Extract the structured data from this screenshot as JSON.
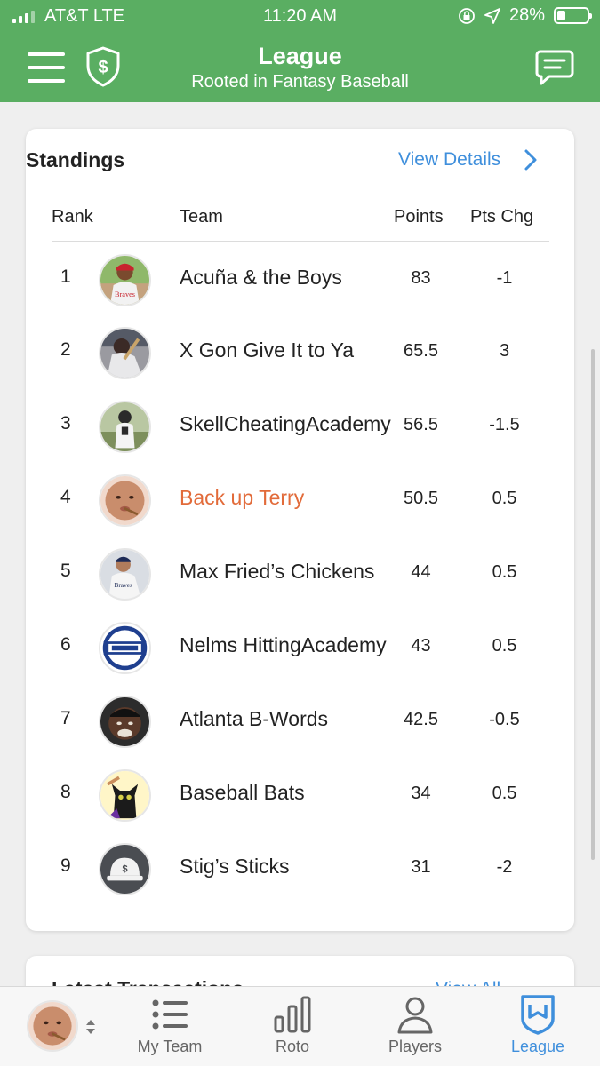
{
  "status_bar": {
    "carrier": "AT&T  LTE",
    "time": "11:20 AM",
    "battery_percent": "28%",
    "battery_level": 0.28
  },
  "header": {
    "title": "League",
    "subtitle": "Rooted in Fantasy Baseball"
  },
  "standings": {
    "title": "Standings",
    "view_details_label": "View Details",
    "columns": {
      "rank": "Rank",
      "team": "Team",
      "points": "Points",
      "pts_chg": "Pts Chg"
    },
    "rows": [
      {
        "rank": "1",
        "team": "Acuña & the Boys",
        "points": "83",
        "pts_chg": "-1"
      },
      {
        "rank": "2",
        "team": "X Gon Give It to Ya",
        "points": "65.5",
        "pts_chg": "3"
      },
      {
        "rank": "3",
        "team": "SkellCheatingAcademy",
        "points": "56.5",
        "pts_chg": "-1.5"
      },
      {
        "rank": "4",
        "team": "Back up Terry",
        "points": "50.5",
        "pts_chg": "0.5"
      },
      {
        "rank": "5",
        "team": "Max Fried’s Chickens",
        "points": "44",
        "pts_chg": "0.5"
      },
      {
        "rank": "6",
        "team": "Nelms HittingAcademy",
        "points": "43",
        "pts_chg": "0.5"
      },
      {
        "rank": "7",
        "team": "Atlanta B-Words",
        "points": "42.5",
        "pts_chg": "-0.5"
      },
      {
        "rank": "8",
        "team": "Baseball Bats",
        "points": "34",
        "pts_chg": "0.5"
      },
      {
        "rank": "9",
        "team": "Stig’s Sticks",
        "points": "31",
        "pts_chg": "-2"
      }
    ]
  },
  "transactions": {
    "title": "Latest Transactions",
    "view_all_label": "View All"
  },
  "tabbar": {
    "tabs": [
      {
        "label": "My Team",
        "icon": "list-icon"
      },
      {
        "label": "Roto",
        "icon": "bar-chart-icon"
      },
      {
        "label": "Players",
        "icon": "person-icon"
      },
      {
        "label": "League",
        "icon": "league-shield-icon"
      }
    ],
    "active_tab": "League"
  },
  "colors": {
    "header_green": "#5aae62",
    "link_blue": "#3f8fdc",
    "my_team_orange": "#e26b3a",
    "background": "#efefef"
  }
}
